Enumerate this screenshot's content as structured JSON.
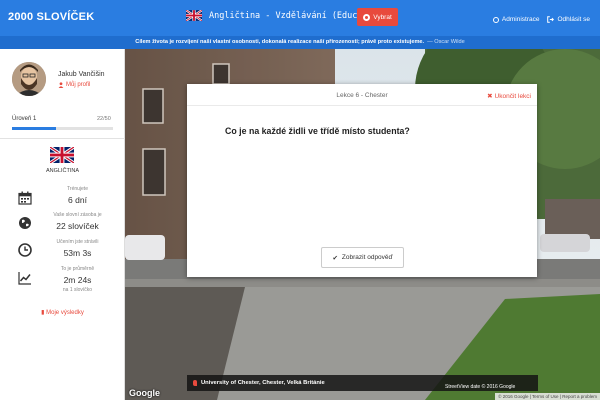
{
  "header": {
    "logo": "2000 SLOVÍČEK",
    "course_title": "Angličtina - Vzdělávání (Education)",
    "choose_label": "Vybrat",
    "admin_label": "Administrace",
    "logout_label": "Odhlásit se",
    "accent_color": "#2a7de1"
  },
  "quote": {
    "text": "Cílem života je rozvíjení naší vlastní osobnosti, dokonalá realizace naší přirozenosti; právě proto existujeme.",
    "author": "— Oscar Wilde"
  },
  "sidebar": {
    "user_name": "Jakub Vančišin",
    "profile_label": "Můj profil",
    "level_label": "Úroveň 1",
    "level_count": "22/50",
    "level_progress": 0.44,
    "language": "ANGLIČTINA",
    "stats": [
      {
        "icon": "calendar-icon",
        "label": "Trénujete",
        "value": "6 dní",
        "sub": ""
      },
      {
        "icon": "globe-icon",
        "label": "Vaše slovní zásoba je",
        "value": "22 slovíček",
        "sub": ""
      },
      {
        "icon": "clock-icon",
        "label": "Učením jste strávili",
        "value": "53m 3s",
        "sub": ""
      },
      {
        "icon": "chart-line-icon",
        "label": "To je průměrně",
        "value": "2m 24s",
        "sub": "na 1 slovíčko"
      }
    ],
    "results_label": "Moje výsledky"
  },
  "streetview": {
    "google_label": "Google",
    "location": "University of Chester, Chester, Velká Británie",
    "date": "StreetView date © 2016 Google",
    "copyright": "© 2016 Google  |  Terms of Use  |  Report a problem"
  },
  "lesson": {
    "title": "Lekce 6 - Chester",
    "end_label": "Ukončit lekci",
    "question": "Co je na každé židli ve třídě místo studenta?",
    "show_answer_label": "Zobrazit odpověď"
  }
}
